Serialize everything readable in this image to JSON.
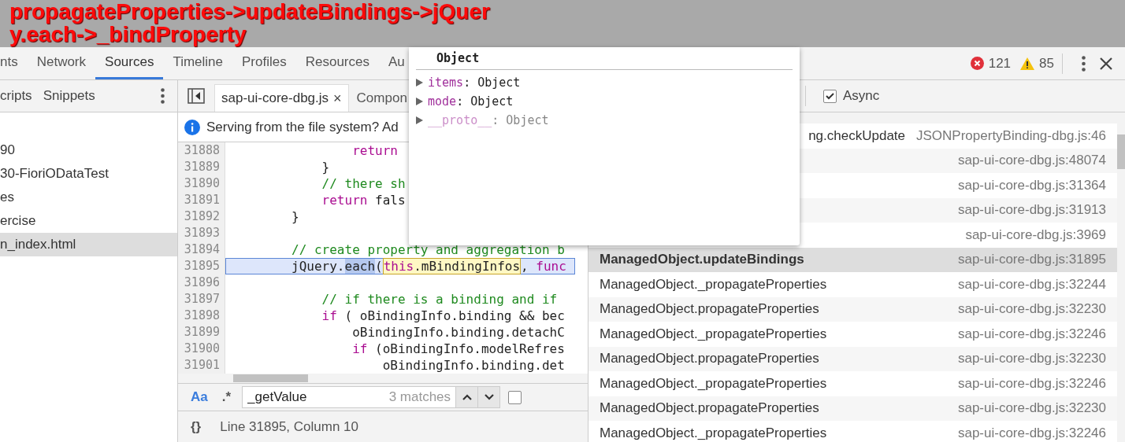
{
  "annotation": {
    "lines": [
      "propagateProperties->updateBindings->jQuer",
      "y.each->_bindProperty"
    ]
  },
  "main_tabs": [
    {
      "label": "nts",
      "selected": false
    },
    {
      "label": "Network",
      "selected": false
    },
    {
      "label": "Sources",
      "selected": true
    },
    {
      "label": "Timeline",
      "selected": false
    },
    {
      "label": "Profiles",
      "selected": false
    },
    {
      "label": "Resources",
      "selected": false
    },
    {
      "label": "Au",
      "selected": false
    }
  ],
  "counters": {
    "errors": "121",
    "warnings": "85"
  },
  "navigator": {
    "tabs": [
      "cripts",
      "Snippets"
    ],
    "items": [
      {
        "label": "90",
        "selected": false
      },
      {
        "label": "30-FioriODataTest",
        "selected": false
      },
      {
        "label": "es",
        "selected": false
      },
      {
        "label": "ercise",
        "selected": false
      },
      {
        "label": "n_index.html",
        "selected": true
      }
    ]
  },
  "editor": {
    "file_tab": "sap-ui-core-dbg.js",
    "file_tab_close": "×",
    "other_tab": "Compon",
    "info": "Serving from the file system? Ad",
    "lines": [
      {
        "number": "31888",
        "current": false,
        "tokens": [
          {
            "kind": "keyword",
            "text": "                return"
          }
        ]
      },
      {
        "number": "31889",
        "current": false,
        "tokens": [
          {
            "kind": "plain",
            "text": "            }"
          }
        ]
      },
      {
        "number": "31890",
        "current": false,
        "tokens": [
          {
            "kind": "comment",
            "text": "            // there sh"
          }
        ]
      },
      {
        "number": "31891",
        "current": false,
        "tokens": [
          {
            "kind": "keyword",
            "text": "            return"
          },
          {
            "kind": "plain",
            "text": " fals"
          }
        ]
      },
      {
        "number": "31892",
        "current": false,
        "tokens": [
          {
            "kind": "plain",
            "text": "        }"
          }
        ]
      },
      {
        "number": "31893",
        "current": false
      },
      {
        "number": "31894",
        "current": false,
        "tokens": [
          {
            "kind": "comment",
            "text": "        // create property and aggregation b"
          }
        ]
      },
      {
        "number": "31895",
        "current": true,
        "tokens": [
          {
            "kind": "plain",
            "text": "        jQuery."
          },
          {
            "kind": "selection",
            "text": "each"
          },
          {
            "kind": "plain",
            "text": "("
          },
          {
            "kind": "match-keyword",
            "text": "this"
          },
          {
            "kind": "match",
            "text": ".mBindingInfos"
          },
          {
            "kind": "plain",
            "text": ", "
          },
          {
            "kind": "keyword",
            "text": "func"
          }
        ]
      },
      {
        "number": "31896",
        "current": false
      },
      {
        "number": "31897",
        "current": false,
        "tokens": [
          {
            "kind": "comment",
            "text": "            // if there is a binding and if"
          }
        ]
      },
      {
        "number": "31898",
        "current": false,
        "tokens": [
          {
            "kind": "keyword",
            "text": "            if"
          },
          {
            "kind": "plain",
            "text": " ( oBindingInfo.binding && bec"
          }
        ]
      },
      {
        "number": "31899",
        "current": false,
        "tokens": [
          {
            "kind": "plain",
            "text": "                oBindingInfo.binding.detachC"
          }
        ]
      },
      {
        "number": "31900",
        "current": false,
        "tokens": [
          {
            "kind": "keyword",
            "text": "                if"
          },
          {
            "kind": "plain",
            "text": " (oBindingInfo.modelRefres"
          }
        ]
      },
      {
        "number": "31901",
        "current": false,
        "tokens": [
          {
            "kind": "plain",
            "text": "                    oBindingInfo.binding.det"
          }
        ]
      }
    ],
    "search": {
      "case_toggle": "Aa",
      "regex_toggle": ".*",
      "value": "_getValue",
      "matches": "3 matches",
      "checked": false
    },
    "status": {
      "format_button": "{}",
      "position": "Line 31895, Column 10"
    }
  },
  "debugger": {
    "async": {
      "label": "Async",
      "checked": true
    },
    "frames": [
      {
        "name": "ng.checkUpdate",
        "kind": "clipped",
        "location": "JSONPropertyBinding-dbg.js:46",
        "selected": false
      },
      {
        "location": "sap-ui-core-dbg.js:48074",
        "selected": false
      },
      {
        "location": "sap-ui-core-dbg.js:31364",
        "selected": false
      },
      {
        "location": "sap-ui-core-dbg.js:31913",
        "selected": false
      },
      {
        "location": "sap-ui-core-dbg.js:3969",
        "selected": false
      },
      {
        "name": "ManagedObject.updateBindings",
        "location": "sap-ui-core-dbg.js:31895",
        "selected": true
      },
      {
        "name": "ManagedObject._propagateProperties",
        "location": "sap-ui-core-dbg.js:32244",
        "selected": false
      },
      {
        "name": "ManagedObject.propagateProperties",
        "location": "sap-ui-core-dbg.js:32230",
        "selected": false
      },
      {
        "name": "ManagedObject._propagateProperties",
        "location": "sap-ui-core-dbg.js:32246",
        "selected": false
      },
      {
        "name": "ManagedObject.propagateProperties",
        "location": "sap-ui-core-dbg.js:32230",
        "selected": false
      },
      {
        "name": "ManagedObject._propagateProperties",
        "location": "sap-ui-core-dbg.js:32246",
        "selected": false
      },
      {
        "name": "ManagedObject.propagateProperties",
        "location": "sap-ui-core-dbg.js:32230",
        "selected": false
      },
      {
        "name": "ManagedObject._propagateProperties",
        "location": "sap-ui-core-dbg.js:32246",
        "selected": false
      }
    ]
  },
  "popover": {
    "title": "Object",
    "properties": [
      {
        "name": "items",
        "separator": ":",
        "value": "Object",
        "dimmed": false
      },
      {
        "name": "mode",
        "separator": ":",
        "value": "Object",
        "dimmed": false
      },
      {
        "name": "__proto__",
        "separator": ":",
        "value": "Object",
        "dimmed": true
      }
    ]
  }
}
